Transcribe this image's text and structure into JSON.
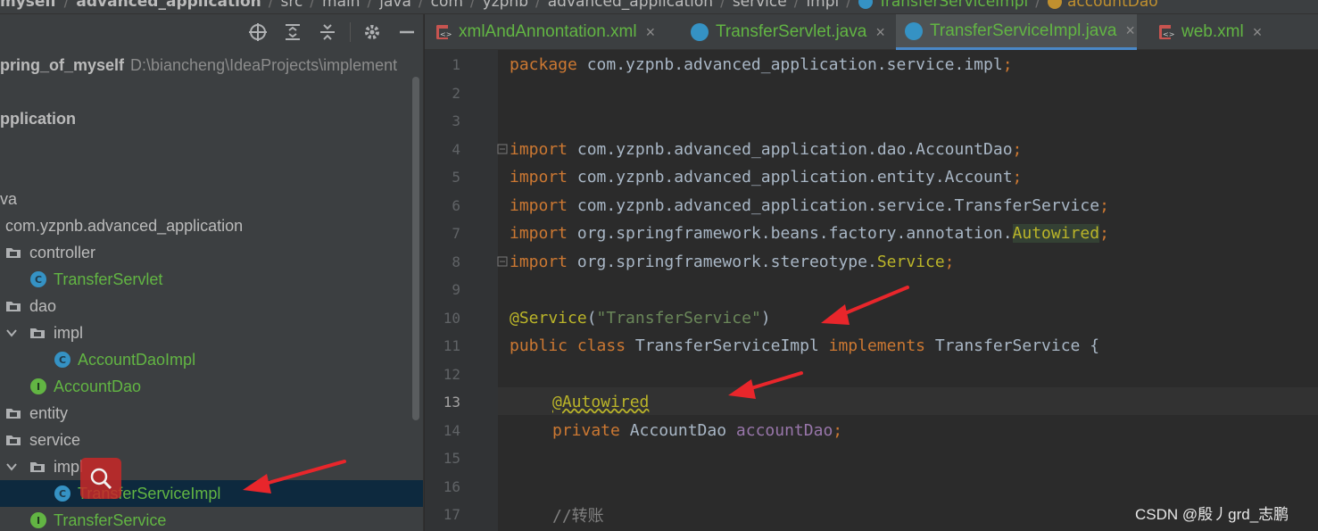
{
  "breadcrumb": {
    "items": [
      "myself",
      "advanced_application",
      "src",
      "main",
      "java",
      "com",
      "yzpnb",
      "advanced_application",
      "service",
      "impl",
      "TransferServiceImpl",
      "accountDao"
    ]
  },
  "project_panel": {
    "toolbar_icons": [
      "locate-icon",
      "expand-all-icon",
      "collapse-all-icon",
      "gear-icon",
      "minimize-icon"
    ],
    "root_name": "pring_of_myself",
    "root_path": "D:\\biancheng\\IdeaProjects\\implement",
    "tree": [
      {
        "label": "pplication"
      },
      {
        "label": "va"
      },
      {
        "label": "com.yzpnb.advanced_application"
      },
      {
        "label": "controller"
      },
      {
        "label": "TransferServlet"
      },
      {
        "label": "dao"
      },
      {
        "label": "impl"
      },
      {
        "label": "AccountDaoImpl"
      },
      {
        "label": "AccountDao"
      },
      {
        "label": "entity"
      },
      {
        "label": "service"
      },
      {
        "label": "impl"
      },
      {
        "label": "TransferServiceImpl"
      },
      {
        "label": "TransferService"
      }
    ]
  },
  "tabs": [
    {
      "label": "xmlAndAnnontation.xml",
      "close": "×"
    },
    {
      "label": "TransferServlet.java",
      "close": "×"
    },
    {
      "label": "TransferServiceImpl.java",
      "close": "×"
    },
    {
      "label": "web.xml",
      "close": "×"
    }
  ],
  "editor": {
    "line_numbers": [
      "1",
      "2",
      "3",
      "4",
      "5",
      "6",
      "7",
      "8",
      "9",
      "10",
      "11",
      "12",
      "13",
      "14",
      "15",
      "16",
      "17"
    ],
    "current_line": "13",
    "code": {
      "l1_kw": "package",
      "l1_rest": " com.yzpnb.advanced_application.service.impl",
      "l1_semi": ";",
      "l4_kw": "import",
      "l4_rest": " com.yzpnb.advanced_application.dao.AccountDao",
      "l5_kw": "import",
      "l5_rest": " com.yzpnb.advanced_application.entity.Account",
      "l6_kw": "import",
      "l6_rest": " com.yzpnb.advanced_application.service.TransferService",
      "l7_kw": "import",
      "l7_rest": " org.springframework.beans.factory.annotation.",
      "l7_hl": "Autowired",
      "l8_kw": "import",
      "l8_rest": " org.springframework.stereotype.",
      "l8_hl": "Service",
      "semi": ";",
      "l10_ann": "@Service",
      "l10_open": "(",
      "l10_str": "\"TransferService\"",
      "l10_close": ")",
      "l11_kw1": "public class",
      "l11_name": " TransferServiceImpl ",
      "l11_kw2": "implements",
      "l11_rest": " TransferService {",
      "l13_ann": "@Autowired",
      "l14_kw": "private",
      "l14_type": " AccountDao ",
      "l14_field": "accountDao",
      "l17_cmt": "//转账"
    }
  },
  "watermark": "CSDN @殷丿grd_志鹏",
  "colors": {
    "keyword": "#cc7832",
    "string": "#6a8759",
    "annotation": "#bbb529",
    "field": "#9876aa",
    "arrow": "#e8262b",
    "selection": "#0d293e",
    "class_icon": "#3592c4",
    "interface_icon": "#62b543"
  }
}
